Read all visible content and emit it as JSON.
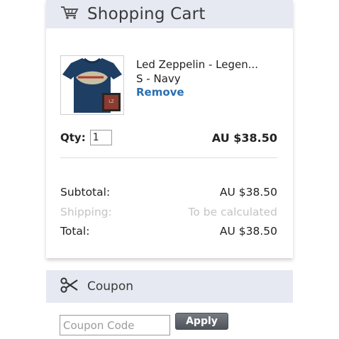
{
  "cart": {
    "title": "Shopping Cart",
    "item": {
      "name": "Led Zeppelin - Legen...",
      "variant": "S - Navy",
      "remove_label": "Remove",
      "qty_label": "Qty:",
      "qty_value": "1",
      "price": "AU $38.50"
    },
    "totals": {
      "subtotal_label": "Subtotal:",
      "subtotal_value": "AU $38.50",
      "shipping_label": "Shipping:",
      "shipping_value": "To be calculated",
      "total_label": "Total:",
      "total_value": "AU $38.50"
    }
  },
  "coupon": {
    "title": "Coupon",
    "placeholder": "Coupon Code",
    "apply_label": "Apply"
  },
  "icons": {
    "cart": "shopping-cart-icon",
    "coupon": "scissors-icon"
  },
  "colors": {
    "header_bg": "#e6e9f1",
    "remove_link": "#2a6eb0",
    "muted_text": "#c4c4c4",
    "apply_button": "#5f636a"
  }
}
